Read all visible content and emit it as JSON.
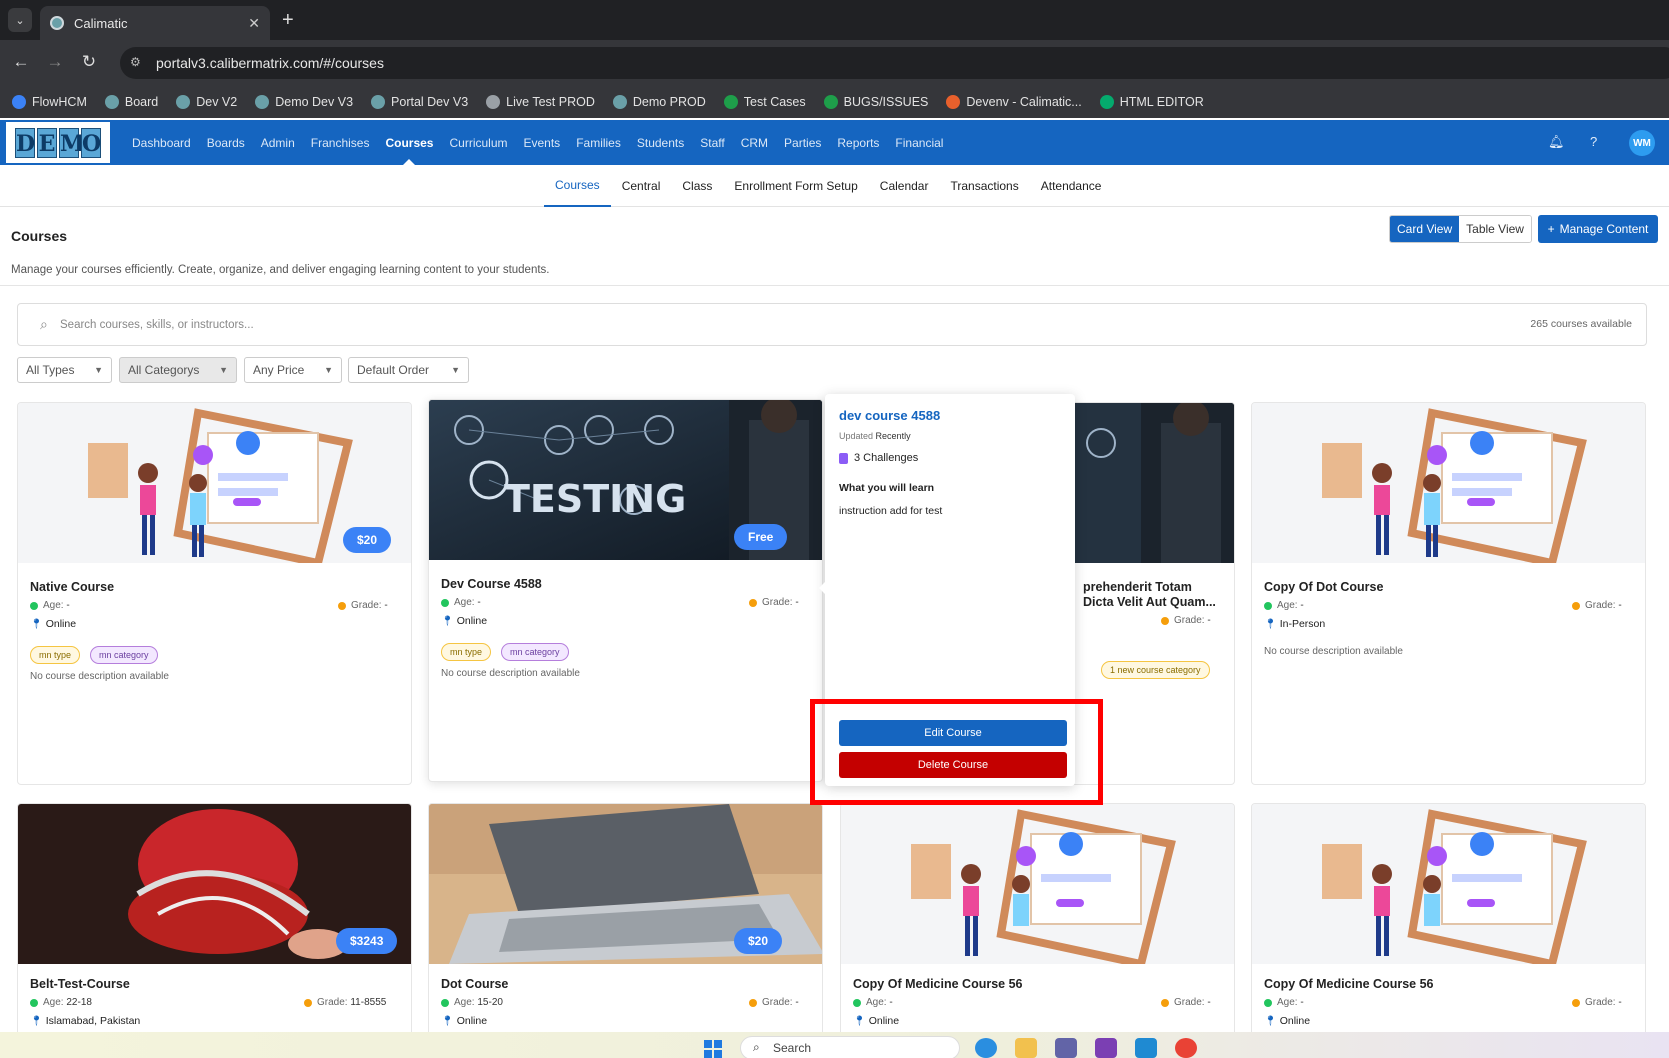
{
  "browser": {
    "tab_title": "Calimatic",
    "url": "portalv3.calibermatrix.com/#/courses",
    "bookmarks": [
      {
        "label": "FlowHCM",
        "icon": "flowhcm-icon",
        "color": "#3b82f6"
      },
      {
        "label": "Board",
        "icon": "globe-icon",
        "color": "#6aa0a8"
      },
      {
        "label": "Dev V2",
        "icon": "globe-icon",
        "color": "#6aa0a8"
      },
      {
        "label": "Demo Dev V3",
        "icon": "globe-icon",
        "color": "#6aa0a8"
      },
      {
        "label": "Portal Dev V3",
        "icon": "globe-icon",
        "color": "#6aa0a8"
      },
      {
        "label": "Live Test PROD",
        "icon": "chart-icon",
        "color": "#9aa0a6"
      },
      {
        "label": "Demo PROD",
        "icon": "globe-icon",
        "color": "#6aa0a8"
      },
      {
        "label": "Test Cases",
        "icon": "sheets-icon",
        "color": "#1e9e4a"
      },
      {
        "label": "BUGS/ISSUES",
        "icon": "sheets-icon",
        "color": "#1e9e4a"
      },
      {
        "label": "Devenv - Calimatic...",
        "icon": "devenv-icon",
        "color": "#e8602c"
      },
      {
        "label": "HTML EDITOR",
        "icon": "w3-icon",
        "color": "#04aa6d"
      }
    ]
  },
  "app": {
    "logo_letters": [
      "D",
      "E",
      "M",
      "O"
    ],
    "nav": [
      "Dashboard",
      "Boards",
      "Admin",
      "Franchises",
      "Courses",
      "Curriculum",
      "Events",
      "Families",
      "Students",
      "Staff",
      "CRM",
      "Parties",
      "Reports",
      "Financial"
    ],
    "active_nav": "Courses",
    "avatar_initials": "WM",
    "subnav": [
      "Courses",
      "Central",
      "Class",
      "Enrollment Form Setup",
      "Calendar",
      "Transactions",
      "Attendance"
    ]
  },
  "page": {
    "title": "Courses",
    "description": "Manage your courses efficiently. Create, organize, and deliver engaging learning content to your students.",
    "card_view_label": "Card View",
    "table_view_label": "Table View",
    "manage_label": "Manage Content",
    "search_placeholder": "Search courses, skills, or instructors...",
    "count_text": "265 courses available",
    "filters": [
      "All Types",
      "All Categorys",
      "Any Price",
      "Default Order"
    ]
  },
  "cards": [
    {
      "title": "Native Course",
      "price": "$20",
      "age_label": "Age:",
      "age": "-",
      "grade_label": "Grade:",
      "grade": "-",
      "location": "Online",
      "tag_type": "mn type",
      "tag_cat": "mn category",
      "desc": "No course description available"
    },
    {
      "title": "Dev Course 4588",
      "price": "Free",
      "age_label": "Age:",
      "age": "-",
      "grade_label": "Grade:",
      "grade": "-",
      "location": "Online",
      "tag_type": "mn type",
      "tag_cat": "mn category",
      "desc": "No course description available",
      "image_text": "TESTING"
    },
    {
      "title_line1": "prehenderit Totam",
      "title_line2": "Dicta Velit Aut Quam...",
      "grade_label": "Grade:",
      "grade": "-",
      "tag_cat": "1 new course category"
    },
    {
      "title": "Copy Of Dot Course",
      "age_label": "Age:",
      "age": "-",
      "grade_label": "Grade:",
      "grade": "-",
      "location": "In-Person",
      "desc": "No course description available"
    },
    {
      "title": "Belt-Test-Course",
      "price": "$3243",
      "age_label": "Age:",
      "age": "22-18",
      "grade_label": "Grade:",
      "grade": "11-8555",
      "location": "Islamabad, Pakistan"
    },
    {
      "title": "Dot Course",
      "price": "$20",
      "age_label": "Age:",
      "age": "15-20",
      "grade_label": "Grade:",
      "grade": "-",
      "location": "Online"
    },
    {
      "title": "Copy Of Medicine Course 56",
      "age_label": "Age:",
      "age": "-",
      "grade_label": "Grade:",
      "grade": "-",
      "location": "Online"
    },
    {
      "title": "Copy Of Medicine Course 56",
      "age_label": "Age:",
      "age": "-",
      "grade_label": "Grade:",
      "grade": "-",
      "location": "Online"
    }
  ],
  "popover": {
    "title": "dev course 4588",
    "updated_label": "Updated",
    "updated_value": "Recently",
    "challenges": "3 Challenges",
    "learn_heading": "What you will learn",
    "learn_text": "instruction add for test",
    "edit_label": "Edit Course",
    "delete_label": "Delete Course"
  },
  "taskbar": {
    "search_label": "Search"
  },
  "colors": {
    "brand": "#1565c0",
    "delete": "#c40000",
    "price_badge": "#3b82f6",
    "highlight": "#ff0000"
  }
}
